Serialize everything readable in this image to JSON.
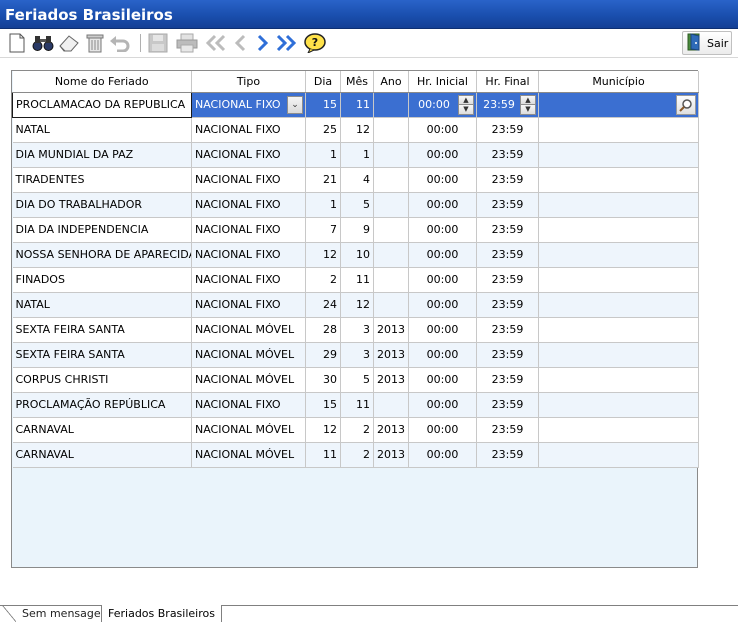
{
  "window": {
    "title": "Feriados Brasileiros"
  },
  "toolbar": {
    "icons": [
      "new-icon",
      "search-icon",
      "eraser-icon",
      "delete-icon",
      "undo-icon",
      "save-icon",
      "print-icon",
      "first-icon",
      "prev-icon",
      "next-icon",
      "last-icon",
      "help-icon"
    ],
    "exit_label": "Sair"
  },
  "grid": {
    "columns": [
      "Nome do Feriado",
      "Tipo",
      "Dia",
      "Mês",
      "Ano",
      "Hr. Inicial",
      "Hr. Final",
      "Município"
    ],
    "rows": [
      [
        "PROCLAMACAO DA REPUBLICA",
        "NACIONAL FIXO",
        "15",
        "11",
        "",
        "00:00",
        "23:59",
        ""
      ],
      [
        "NATAL",
        "NACIONAL FIXO",
        "25",
        "12",
        "",
        "00:00",
        "23:59",
        ""
      ],
      [
        "DIA MUNDIAL DA PAZ",
        "NACIONAL FIXO",
        "1",
        "1",
        "",
        "00:00",
        "23:59",
        ""
      ],
      [
        "TIRADENTES",
        "NACIONAL FIXO",
        "21",
        "4",
        "",
        "00:00",
        "23:59",
        ""
      ],
      [
        "DIA DO TRABALHADOR",
        "NACIONAL FIXO",
        "1",
        "5",
        "",
        "00:00",
        "23:59",
        ""
      ],
      [
        "DIA DA INDEPENDENCIA",
        "NACIONAL FIXO",
        "7",
        "9",
        "",
        "00:00",
        "23:59",
        ""
      ],
      [
        "NOSSA SENHORA DE APARECIDA",
        "NACIONAL FIXO",
        "12",
        "10",
        "",
        "00:00",
        "23:59",
        ""
      ],
      [
        "FINADOS",
        "NACIONAL FIXO",
        "2",
        "11",
        "",
        "00:00",
        "23:59",
        ""
      ],
      [
        "NATAL",
        "NACIONAL FIXO",
        "24",
        "12",
        "",
        "00:00",
        "23:59",
        ""
      ],
      [
        "SEXTA FEIRA SANTA",
        "NACIONAL MÓVEL",
        "28",
        "3",
        "2013",
        "00:00",
        "23:59",
        ""
      ],
      [
        "SEXTA FEIRA SANTA",
        "NACIONAL MÓVEL",
        "29",
        "3",
        "2013",
        "00:00",
        "23:59",
        ""
      ],
      [
        "CORPUS CHRISTI",
        "NACIONAL MÓVEL",
        "30",
        "5",
        "2013",
        "00:00",
        "23:59",
        ""
      ],
      [
        "PROCLAMAÇÃO REPÚBLICA",
        "NACIONAL FIXO",
        "15",
        "11",
        "",
        "00:00",
        "23:59",
        ""
      ],
      [
        "CARNAVAL",
        "NACIONAL MÓVEL",
        "12",
        "2",
        "2013",
        "00:00",
        "23:59",
        ""
      ],
      [
        "CARNAVAL",
        "NACIONAL MÓVEL",
        "11",
        "2",
        "2013",
        "00:00",
        "23:59",
        ""
      ]
    ],
    "selected_row": 0
  },
  "tabs": [
    {
      "label": "Sem mensagens",
      "active": false
    },
    {
      "label": "Feriados Brasileiros",
      "active": true
    }
  ],
  "colors": {
    "titlebar": "#1a4fae",
    "selection": "#3b6fd1",
    "grid_bg": "#eaf4fb"
  }
}
